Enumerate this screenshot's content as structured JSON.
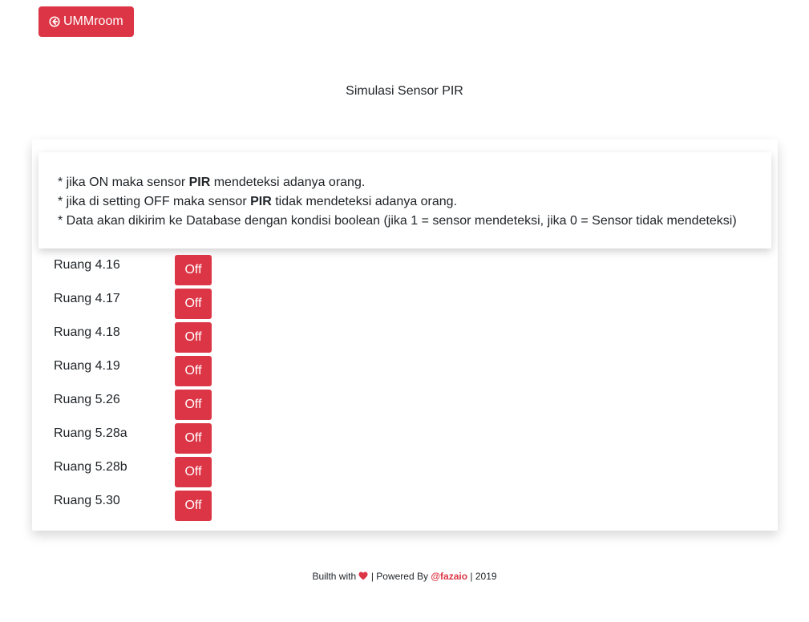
{
  "header": {
    "back_button_label": "UMMroom",
    "back_button_icon": "arrow-circle-left-icon"
  },
  "page_title": "Simulasi Sensor PIR",
  "info": {
    "line1_pre": "* jika ON maka sensor ",
    "line1_bold": "PIR",
    "line1_post": " mendeteksi adanya orang.",
    "line2_pre": "* jika di setting OFF maka sensor ",
    "line2_bold": "PIR",
    "line2_post": " tidak mendeteksi adanya orang.",
    "line3": "* Data akan dikirim ke Database dengan kondisi boolean (jika 1 = sensor mendeteksi, jika 0 = Sensor tidak mendeteksi)"
  },
  "rooms": [
    {
      "label": "Ruang 4.16",
      "state": "Off"
    },
    {
      "label": "Ruang 4.17",
      "state": "Off"
    },
    {
      "label": "Ruang 4.18",
      "state": "Off"
    },
    {
      "label": "Ruang 4.19",
      "state": "Off"
    },
    {
      "label": "Ruang 5.26",
      "state": "Off"
    },
    {
      "label": "Ruang 5.28a",
      "state": "Off"
    },
    {
      "label": "Ruang 5.28b",
      "state": "Off"
    },
    {
      "label": "Ruang 5.30",
      "state": "Off"
    }
  ],
  "footer": {
    "built_with": "Builth with",
    "heart_icon": "heart-icon",
    "powered_by": "| Powered By",
    "author": "@fazaio",
    "year": "| 2019"
  },
  "colors": {
    "accent": "#dc3545",
    "text": "#212529"
  }
}
